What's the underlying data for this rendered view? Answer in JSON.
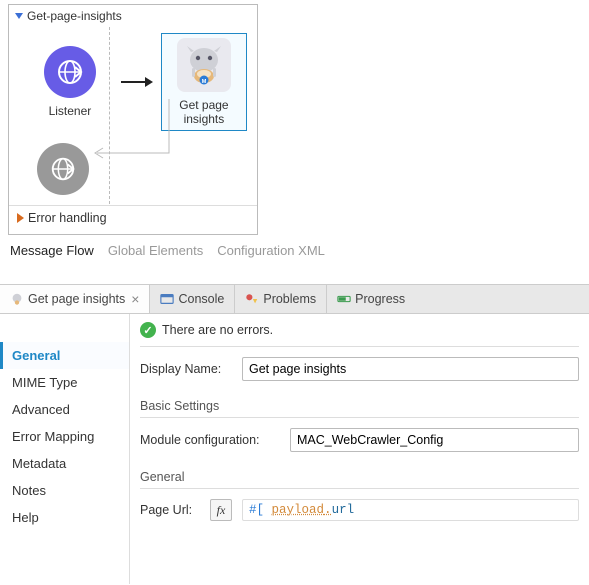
{
  "canvas": {
    "title": "Get-page-insights",
    "listener_label": "Listener",
    "insights_label": "Get page insights",
    "error_label": "Error handling"
  },
  "editor_tabs": [
    "Message Flow",
    "Global Elements",
    "Configuration XML"
  ],
  "editor_tab_active": 0,
  "panel_tabs": {
    "open": "Get page insights",
    "console": "Console",
    "problems": "Problems",
    "progress": "Progress"
  },
  "status": {
    "text": "There are no errors."
  },
  "sidebar": {
    "items": [
      "General",
      "MIME Type",
      "Advanced",
      "Error Mapping",
      "Metadata",
      "Notes",
      "Help"
    ],
    "active": 0
  },
  "form": {
    "display_name_label": "Display Name:",
    "display_name_value": "Get page insights",
    "basic_settings_head": "Basic Settings",
    "module_config_label": "Module configuration:",
    "module_config_value": "MAC_WebCrawler_Config",
    "general_head": "General",
    "page_url_label": "Page Url:",
    "page_url_dw": "#[",
    "page_url_var": "payload",
    "page_url_sep": ".",
    "page_url_attr": "url"
  },
  "icons": {
    "globe_arrow": "globe-arrow-icon",
    "fx": "fx"
  }
}
